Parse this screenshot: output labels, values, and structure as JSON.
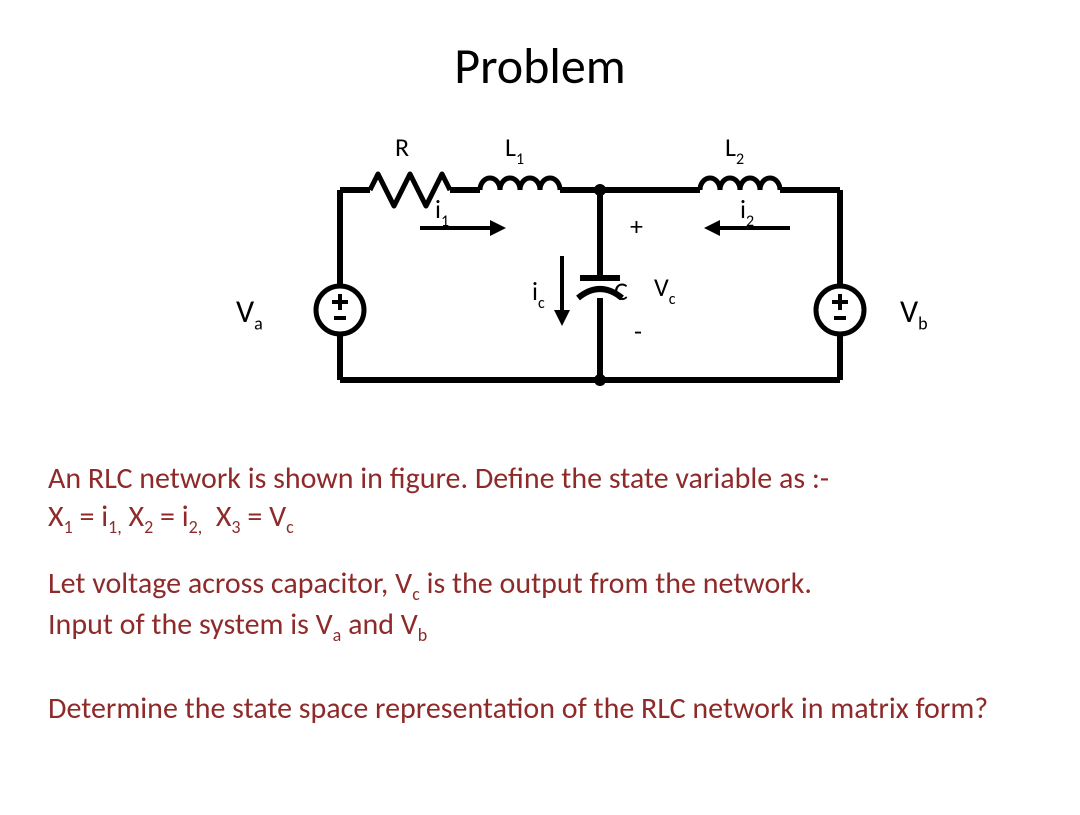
{
  "title": "Problem",
  "circuit": {
    "labels": {
      "R": "R",
      "L1": "L",
      "L1_sub": "1",
      "L2": "L",
      "L2_sub": "2",
      "i1": "i",
      "i1_sub": "1",
      "i2": "i",
      "i2_sub": "2",
      "ic": "i",
      "ic_sub": "c",
      "C": "C",
      "plus": "+",
      "minus": "-",
      "Vc": "V",
      "Vc_sub": "c",
      "Va": "V",
      "Va_sub": "a",
      "Vb": "V",
      "Vb_sub": "b"
    }
  },
  "paragraphs": {
    "p1_line1": "An RLC network is shown in figure. Define the state variable as :-",
    "p1_eq_x1": "X",
    "p1_eq_x1s": "1",
    "p1_eq_i1": "i",
    "p1_eq_i1s": "1,",
    "p1_eq_x2": "X",
    "p1_eq_x2s": "2",
    "p1_eq_i2": "i",
    "p1_eq_i2s": "2,",
    "p1_eq_x3": "X",
    "p1_eq_x3s": "3",
    "p1_eq_vc": "V",
    "p1_eq_vcs": "c",
    "p2_a": "Let voltage across capacitor, V",
    "p2_vcs": "c",
    "p2_b": " is the output from the network.",
    "p2_c": "Input of the system is V",
    "p2_vas": "a",
    "p2_d": " and V",
    "p2_vbs": "b",
    "p3": "Determine the state space representation of the RLC network in matrix form?"
  },
  "chart_data": {
    "type": "circuit-diagram",
    "sources": [
      {
        "name": "Va",
        "type": "dc",
        "position": "left"
      },
      {
        "name": "Vb",
        "type": "dc",
        "position": "right"
      }
    ],
    "components": [
      {
        "name": "R",
        "type": "resistor",
        "branch": "left-top"
      },
      {
        "name": "L1",
        "type": "inductor",
        "branch": "left-top",
        "current": "i1"
      },
      {
        "name": "L2",
        "type": "inductor",
        "branch": "right-top",
        "current": "i2"
      },
      {
        "name": "C",
        "type": "capacitor",
        "branch": "center",
        "voltage": "Vc",
        "current": "ic"
      }
    ],
    "currents": {
      "i1": "left-to-right through R and L1",
      "i2": "right-to-left through L2",
      "ic": "top-to-bottom through C"
    },
    "state_variables": [
      "i1",
      "i2",
      "Vc"
    ],
    "inputs": [
      "Va",
      "Vb"
    ],
    "output": "Vc"
  }
}
